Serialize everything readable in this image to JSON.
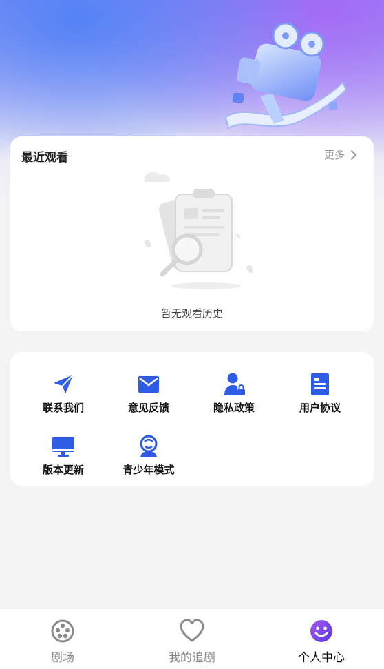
{
  "recent": {
    "title": "最近观看",
    "more_label": "更多",
    "empty_text": "暂无观看历史"
  },
  "menu": {
    "items": [
      {
        "label": "联系我们",
        "icon": "send-icon"
      },
      {
        "label": "意见反馈",
        "icon": "mail-icon"
      },
      {
        "label": "隐私政策",
        "icon": "user-lock-icon"
      },
      {
        "label": "用户协议",
        "icon": "document-icon"
      },
      {
        "label": "版本更新",
        "icon": "monitor-icon"
      },
      {
        "label": "青少年模式",
        "icon": "kid-icon"
      }
    ]
  },
  "tabbar": {
    "items": [
      {
        "label": "剧场",
        "icon": "film-reel-icon"
      },
      {
        "label": "我的追剧",
        "icon": "heart-icon"
      },
      {
        "label": "个人中心",
        "icon": "smiley-icon",
        "active": true
      }
    ]
  },
  "colors": {
    "accent": "#2f5ce6",
    "active_tab": "#7b3fe4"
  }
}
